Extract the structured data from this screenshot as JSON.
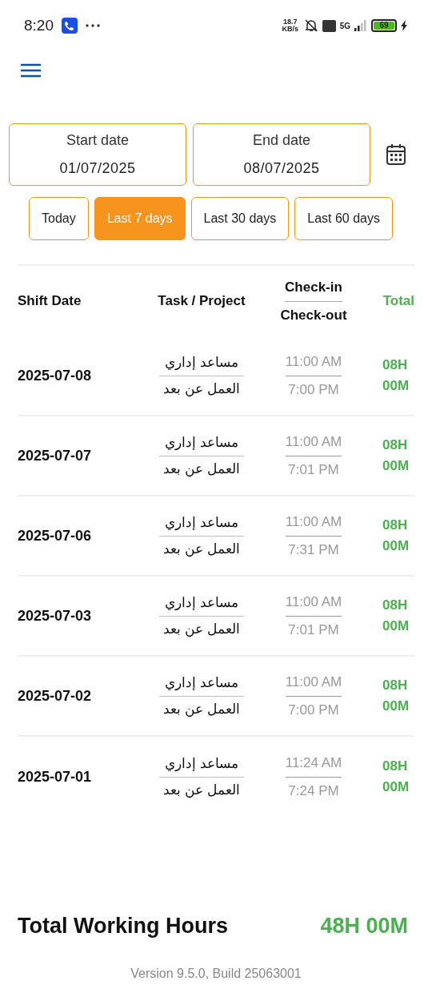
{
  "status_bar": {
    "time": "8:20",
    "speed": "18.7 KB/s",
    "network": "5G",
    "battery": "69"
  },
  "date_range": {
    "start_label": "Start date",
    "start_value": "01/07/2025",
    "end_label": "End date",
    "end_value": "08/07/2025"
  },
  "presets": [
    {
      "label": "Today",
      "selected": false
    },
    {
      "label": "Last 7 days",
      "selected": true
    },
    {
      "label": "Last 30 days",
      "selected": false
    },
    {
      "label": "Last 60 days",
      "selected": false
    }
  ],
  "table": {
    "columns": {
      "shift_date": "Shift Date",
      "task": "Task / Project",
      "check_in": "Check-in",
      "check_out": "Check-out",
      "total": "Total"
    },
    "rows": [
      {
        "date": "2025-07-08",
        "task": "مساعد إداري",
        "project": "العمل عن بعد",
        "check_in": "11:00 AM",
        "check_out": "7:00 PM",
        "total": "08H 00M"
      },
      {
        "date": "2025-07-07",
        "task": "مساعد إداري",
        "project": "العمل عن بعد",
        "check_in": "11:00 AM",
        "check_out": "7:01 PM",
        "total": "08H 00M"
      },
      {
        "date": "2025-07-06",
        "task": "مساعد إداري",
        "project": "العمل عن بعد",
        "check_in": "11:00 AM",
        "check_out": "7:31 PM",
        "total": "08H 00M"
      },
      {
        "date": "2025-07-03",
        "task": "مساعد إداري",
        "project": "العمل عن بعد",
        "check_in": "11:00 AM",
        "check_out": "7:01 PM",
        "total": "08H 00M"
      },
      {
        "date": "2025-07-02",
        "task": "مساعد إداري",
        "project": "العمل عن بعد",
        "check_in": "11:00 AM",
        "check_out": "7:00 PM",
        "total": "08H 00M"
      },
      {
        "date": "2025-07-01",
        "task": "مساعد إداري",
        "project": "العمل عن بعد",
        "check_in": "11:24 AM",
        "check_out": "7:24 PM",
        "total": "08H 00M"
      }
    ]
  },
  "summary": {
    "label": "Total Working Hours",
    "value": "48H 00M"
  },
  "version": "Version 9.5.0, Build 25063001"
}
